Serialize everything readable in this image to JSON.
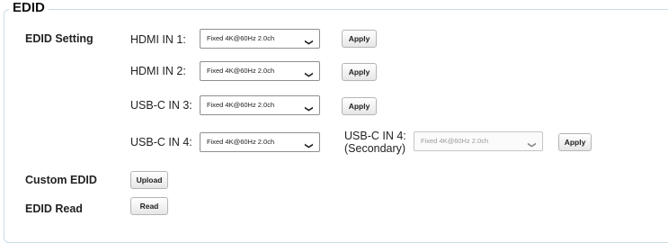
{
  "section": {
    "title": "EDID"
  },
  "edid_setting": {
    "label": "EDID Setting",
    "rows": [
      {
        "port": "HDMI IN 1:",
        "value": "Fixed 4K@60Hz 2.0ch",
        "apply_label": "Apply"
      },
      {
        "port": "HDMI IN 2:",
        "value": "Fixed 4K@60Hz 2.0ch",
        "apply_label": "Apply"
      },
      {
        "port": "USB-C IN 3:",
        "value": "Fixed 4K@60Hz 2.0ch",
        "apply_label": "Apply"
      },
      {
        "port": "USB-C IN 4:",
        "value": "Fixed 4K@60Hz 2.0ch",
        "apply_label": "Apply"
      }
    ],
    "secondary": {
      "port_line1": "USB-C IN 4:",
      "port_line2": "(Secondary)",
      "value": "Fixed 4K@60Hz 2.0ch",
      "apply_label": "Apply",
      "disabled": true
    }
  },
  "custom_edid": {
    "label": "Custom EDID",
    "button_label": "Upload"
  },
  "edid_read": {
    "label": "EDID Read",
    "button_label": "Read"
  },
  "icons": {
    "dropdown": "chevron-down-icon"
  }
}
